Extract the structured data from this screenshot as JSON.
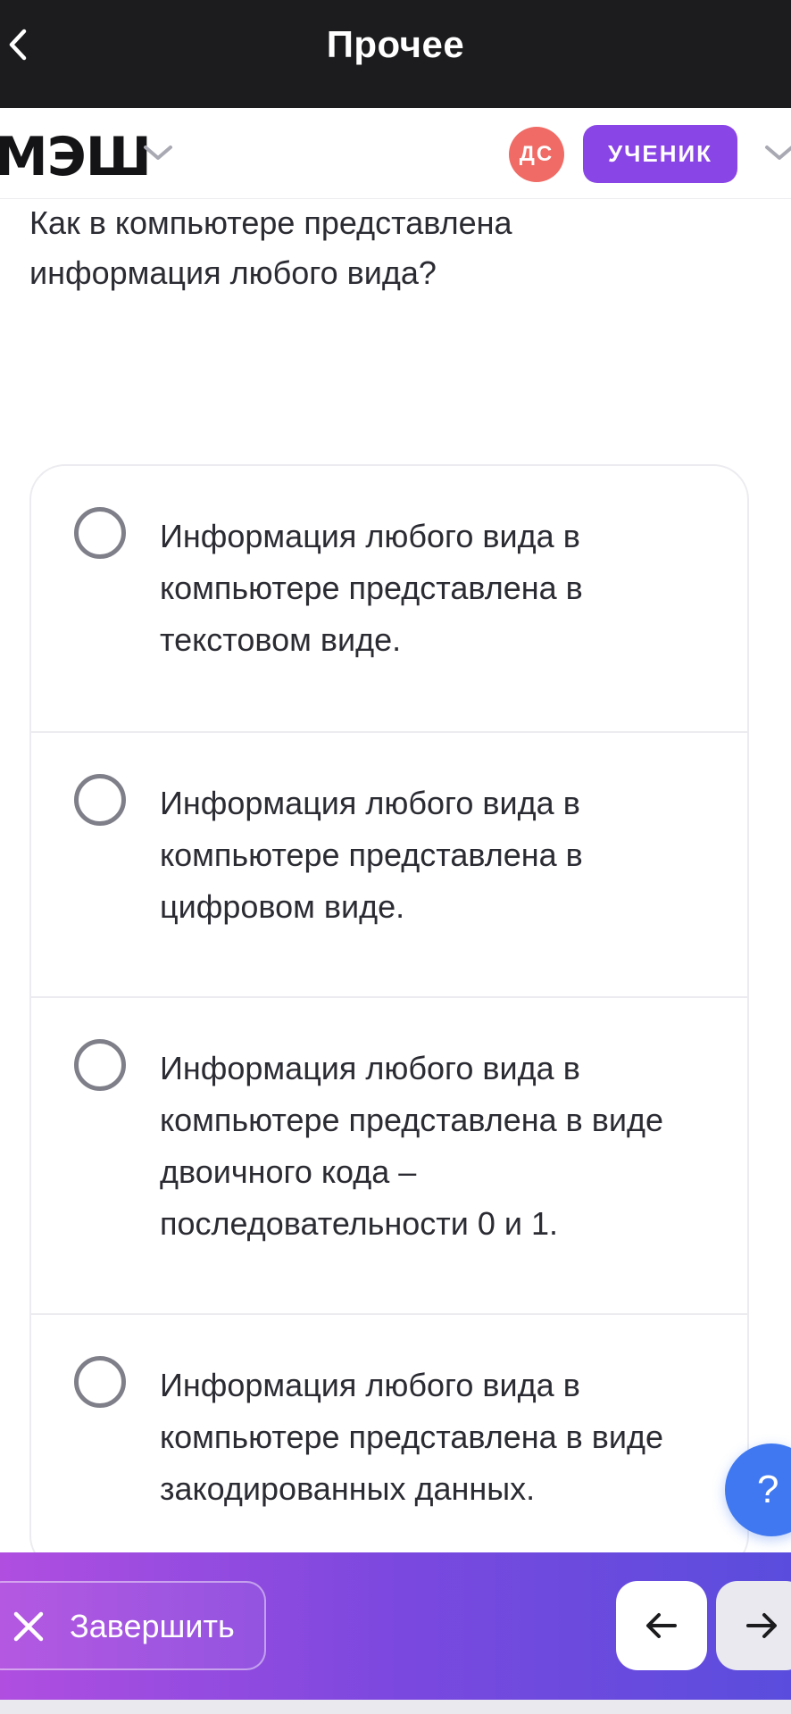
{
  "topbar": {
    "title": "Прочее",
    "back_icon": "chevron-left-icon"
  },
  "appbar": {
    "logo": "МЭШ",
    "avatar_initials": "ДС",
    "role": "УЧЕНИК",
    "colors": {
      "avatar": "#f06b65",
      "role_badge": "#8a45e6"
    }
  },
  "question": {
    "text": "Как в компьютере представлена информация любого вида?"
  },
  "options": [
    {
      "text": "Информация любого вида в компьютере представлена  в текстовом виде.",
      "selected": false
    },
    {
      "text": "Информация любого вида в компьютере представлена в цифровом виде.",
      "selected": false
    },
    {
      "text": "Информация любого вида в компьютере представлена в виде двоичного кода – последовательности 0 и 1.",
      "selected": false
    },
    {
      "text": "Информация любого вида в компьютере представлена в виде закодированных данных.",
      "selected": false
    }
  ],
  "help": {
    "label": "?"
  },
  "bottombar": {
    "finish_label": "Завершить",
    "prev_icon": "arrow-left-icon",
    "next_icon": "arrow-right-icon",
    "colors": {
      "gradient_start": "#b04ee0",
      "gradient_end": "#5a4ddd",
      "help_button": "#3f78f0"
    }
  }
}
